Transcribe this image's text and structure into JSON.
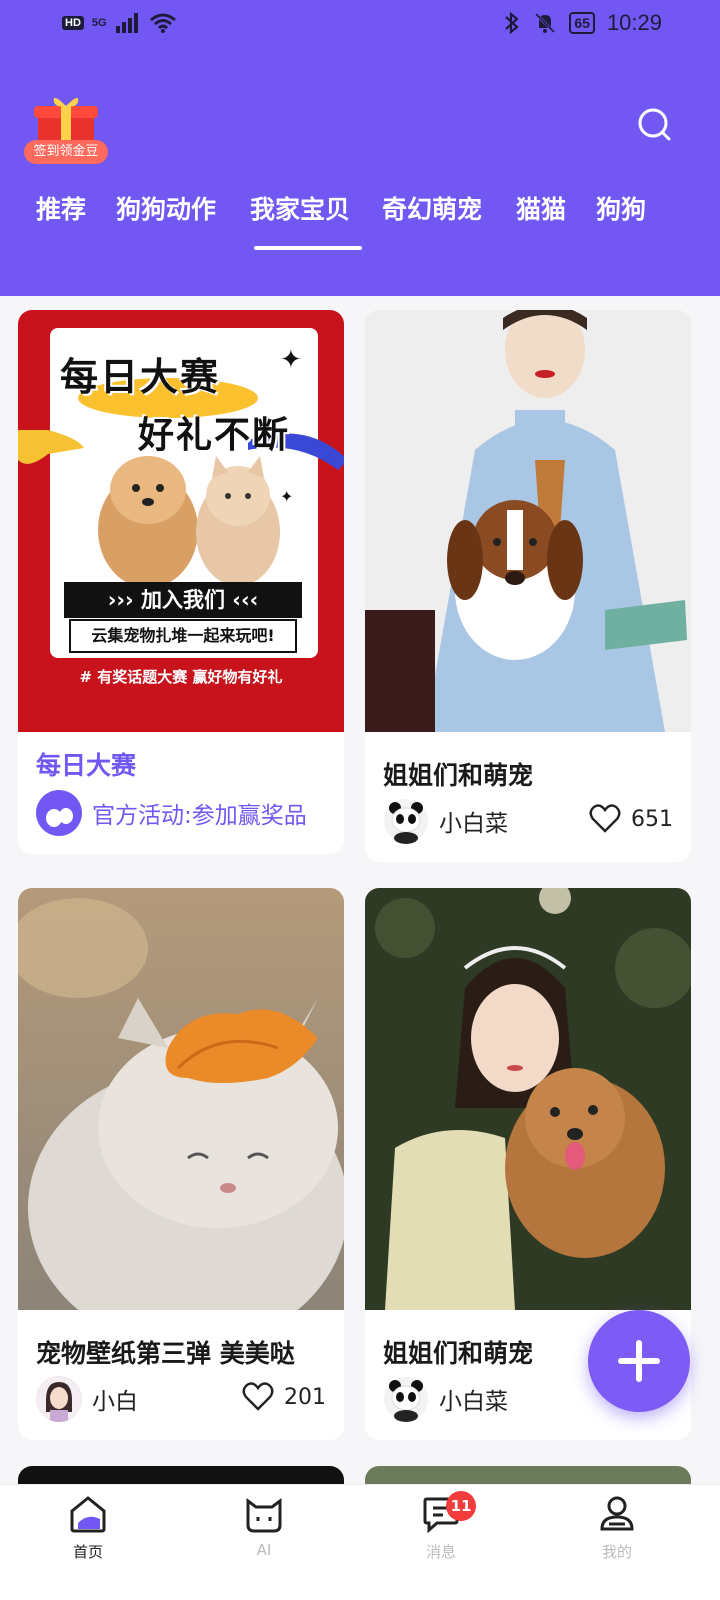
{
  "status": {
    "network_badge": "HD",
    "network_type": "5G",
    "battery": "65",
    "time": "10:29"
  },
  "header": {
    "gift_label": "签到领金豆",
    "tabs": [
      {
        "label": "推荐"
      },
      {
        "label": "狗狗动作"
      },
      {
        "label": "我家宝贝"
      },
      {
        "label": "奇幻萌宠"
      },
      {
        "label": "猫猫"
      },
      {
        "label": "狗狗"
      }
    ]
  },
  "cards": [
    {
      "title": "每日大赛",
      "poster": {
        "line1": "每日大赛",
        "line2": "好礼不断",
        "join": "加入我们",
        "slogan": "云集宠物扎堆一起来玩吧!",
        "footer": "# 有奖话题大赛 赢好物有好礼"
      },
      "author": "官方活动:参加赢奖品"
    },
    {
      "title": "姐姐们和萌宠",
      "author": "小白菜",
      "likes": "651"
    },
    {
      "title": "宠物壁纸第三弹 美美哒",
      "author": "小白",
      "likes": "201"
    },
    {
      "title": "姐姐们和萌宠",
      "author": "小白菜",
      "likes": ""
    }
  ],
  "bottom_nav": [
    {
      "label": "首页",
      "icon": "home-icon"
    },
    {
      "label": "AI",
      "icon": "cat-face-icon"
    },
    {
      "label": "消息",
      "icon": "message-icon",
      "badge": "11"
    },
    {
      "label": "我的",
      "icon": "profile-icon"
    }
  ],
  "colors": {
    "brand": "#7357f3",
    "accent_text": "#7357f3",
    "badge": "#f23c3c"
  }
}
